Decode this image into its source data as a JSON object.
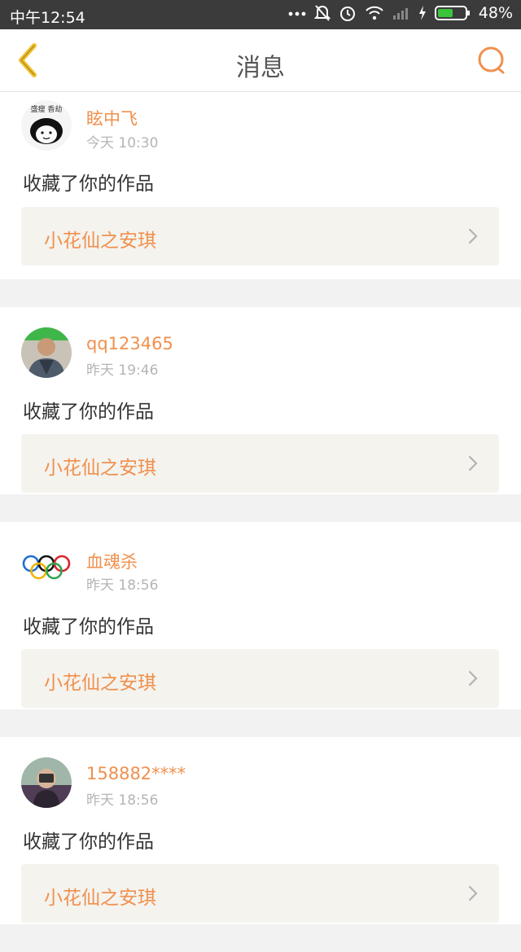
{
  "status": {
    "time": "中午12:54",
    "battery": "48%"
  },
  "nav": {
    "title": "消息"
  },
  "messages": [
    {
      "username": "眩中飞",
      "time": "今天 10:30",
      "action": "收藏了你的作品",
      "work": "小花仙之安琪",
      "avatar_text": "盛瘦 香劫"
    },
    {
      "username": "qq123465",
      "time": "昨天 19:46",
      "action": "收藏了你的作品",
      "work": "小花仙之安琪"
    },
    {
      "username": "血魂杀",
      "time": "昨天 18:56",
      "action": "收藏了你的作品",
      "work": "小花仙之安琪"
    },
    {
      "username": "158882****",
      "time": "昨天 18:56",
      "action": "收藏了你的作品",
      "work": "小花仙之安琪"
    }
  ],
  "colors": {
    "accent": "#f0904e",
    "back_icon": "#f2c230",
    "statusbar": "#3b3b3b",
    "battery_fill": "#3cc43c"
  }
}
